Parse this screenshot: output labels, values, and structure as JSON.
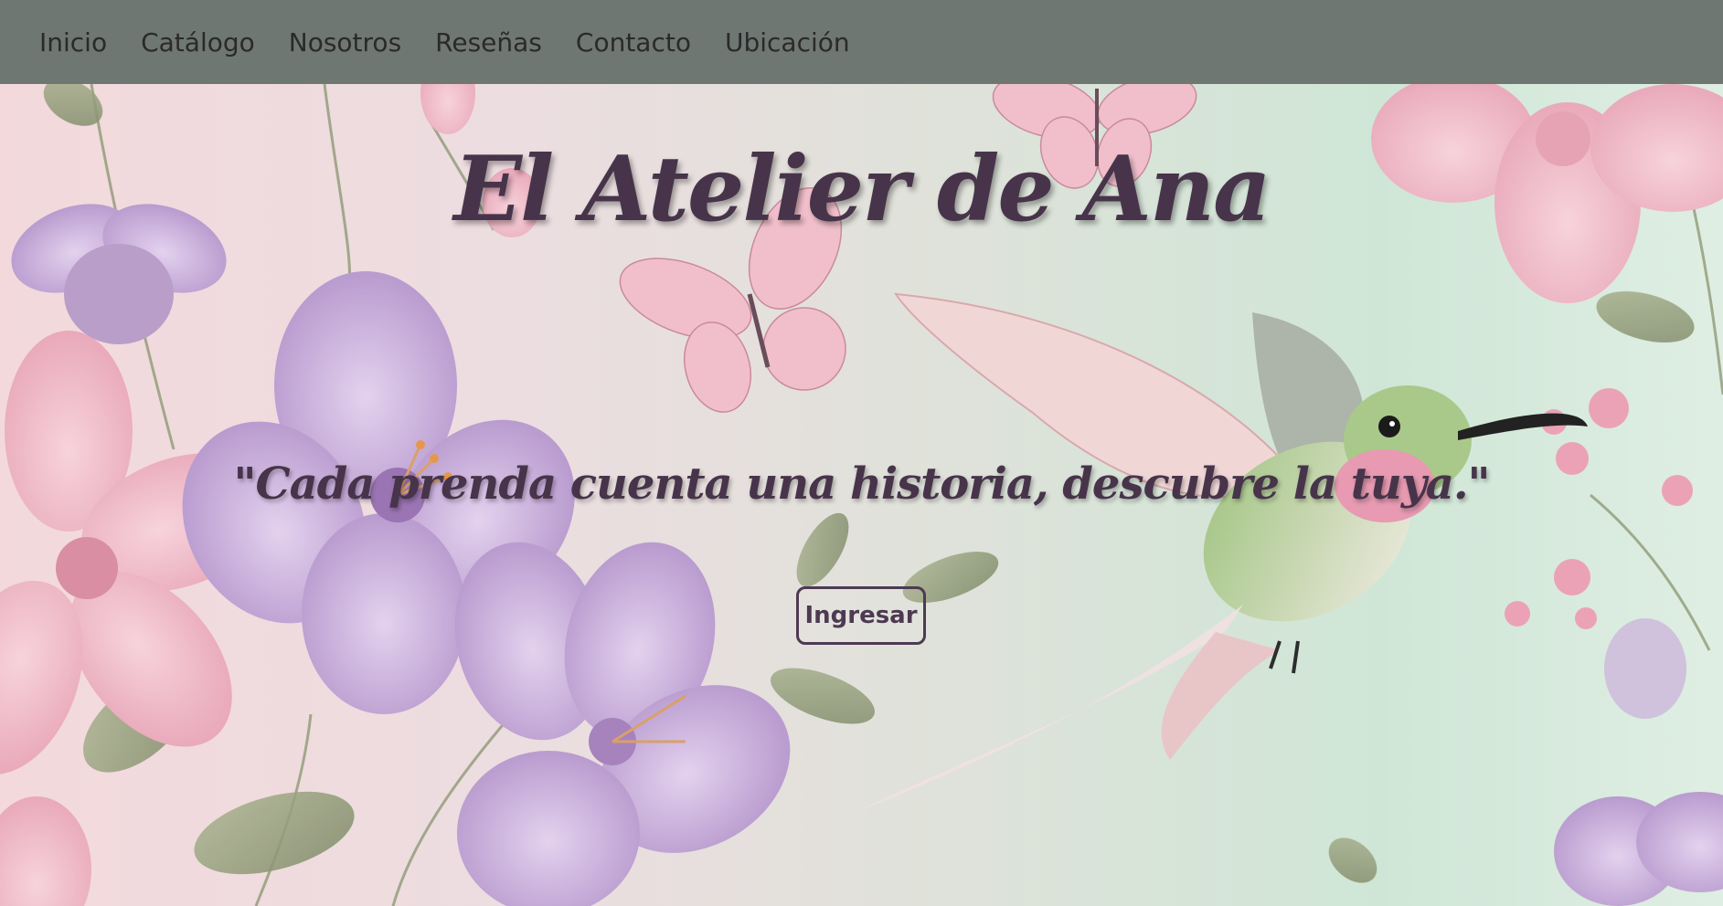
{
  "nav": {
    "items": [
      {
        "label": "Inicio"
      },
      {
        "label": "Catálogo"
      },
      {
        "label": "Nosotros"
      },
      {
        "label": "Reseñas"
      },
      {
        "label": "Contacto"
      },
      {
        "label": "Ubicación"
      }
    ]
  },
  "hero": {
    "title": "El Atelier de Ana",
    "tagline": "\"Cada prenda cuenta una historia, descubre la tuya.\"",
    "button_label": "Ingresar",
    "background_image": "floral-hummingbird-illustration"
  },
  "colors": {
    "navbar_bg": "#6f7773",
    "nav_text": "#2a2a2a",
    "title_text": "#47344a",
    "button_border": "#4d3a52"
  }
}
